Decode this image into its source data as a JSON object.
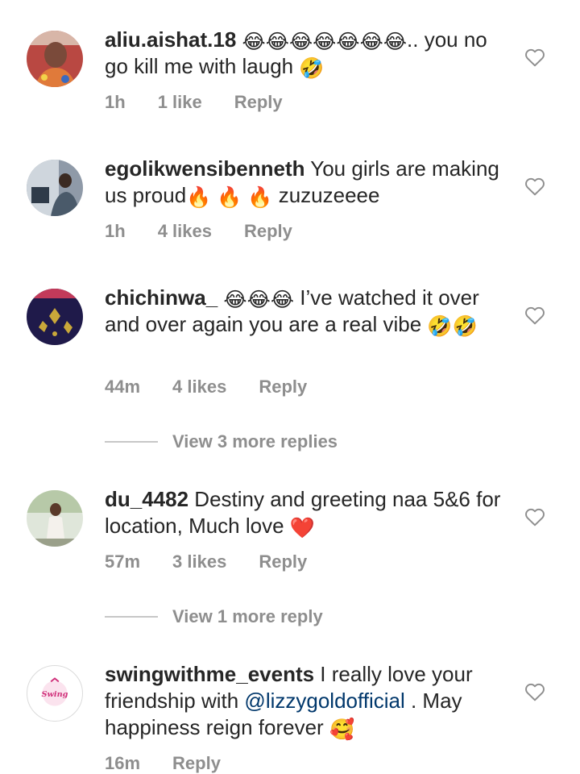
{
  "comments": [
    {
      "username": "aliu.aishat.18",
      "text_pre": " ",
      "emoji_a": "😂😂😂😂😂😂😂",
      "text_mid": ".. you no go kill me with laugh ",
      "emoji_b": "🤣",
      "time": "1h",
      "likes": "1 like",
      "reply": "Reply"
    },
    {
      "username": "egolikwensibenneth",
      "text_pre": " You girls are making us proud",
      "emoji_a": "🔥 🔥 🔥",
      "text_mid": "zuzuzeeee",
      "time": "1h",
      "likes": "4 likes",
      "reply": "Reply"
    },
    {
      "username": "chichinwa_",
      "emoji_a": "😂😂😂",
      "text_mid": " I’ve watched it over and over again you are a real vibe ",
      "emoji_b": "🤣🤣",
      "time": "44m",
      "likes": "4 likes",
      "reply": "Reply",
      "view_replies": "View 3 more replies"
    },
    {
      "username": "du_4482",
      "text_mid": " Destiny and greeting naa 5&6 for location, Much love ",
      "emoji_b": "❤️",
      "time": "57m",
      "likes": "3 likes",
      "reply": "Reply",
      "view_replies": "View 1 more reply"
    },
    {
      "username": "swingwithme_events",
      "text_pre": " I really love your friendship with ",
      "mention": "@lizzygoldofficial",
      "text_mid": " . May happiness reign forever ",
      "emoji_b": "🥰",
      "time": "16m",
      "likes": "",
      "reply": "Reply",
      "avatar_logo": "Swing"
    }
  ],
  "colors": {
    "meta": "#8e8e8e",
    "mention": "#00376b",
    "text": "#262626"
  },
  "icons": {
    "like": "heart-outline-icon"
  }
}
